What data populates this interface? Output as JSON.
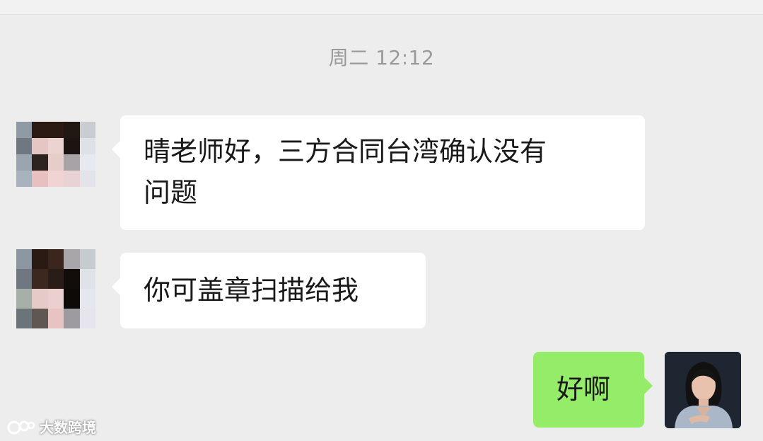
{
  "chat": {
    "timestamp": "周二 12:12",
    "messages": [
      {
        "sender": "other",
        "text_line1": "晴老师好，三方合同台湾确认没有",
        "text_line2": "问题"
      },
      {
        "sender": "other",
        "text": "你可盖章扫描给我"
      },
      {
        "sender": "me",
        "text": "好啊"
      }
    ]
  },
  "watermark": {
    "logo": "大数跨境"
  },
  "colors": {
    "background": "#ededed",
    "incoming_bubble": "#ffffff",
    "outgoing_bubble": "#95ec69",
    "timestamp_text": "#9a9a9a"
  }
}
